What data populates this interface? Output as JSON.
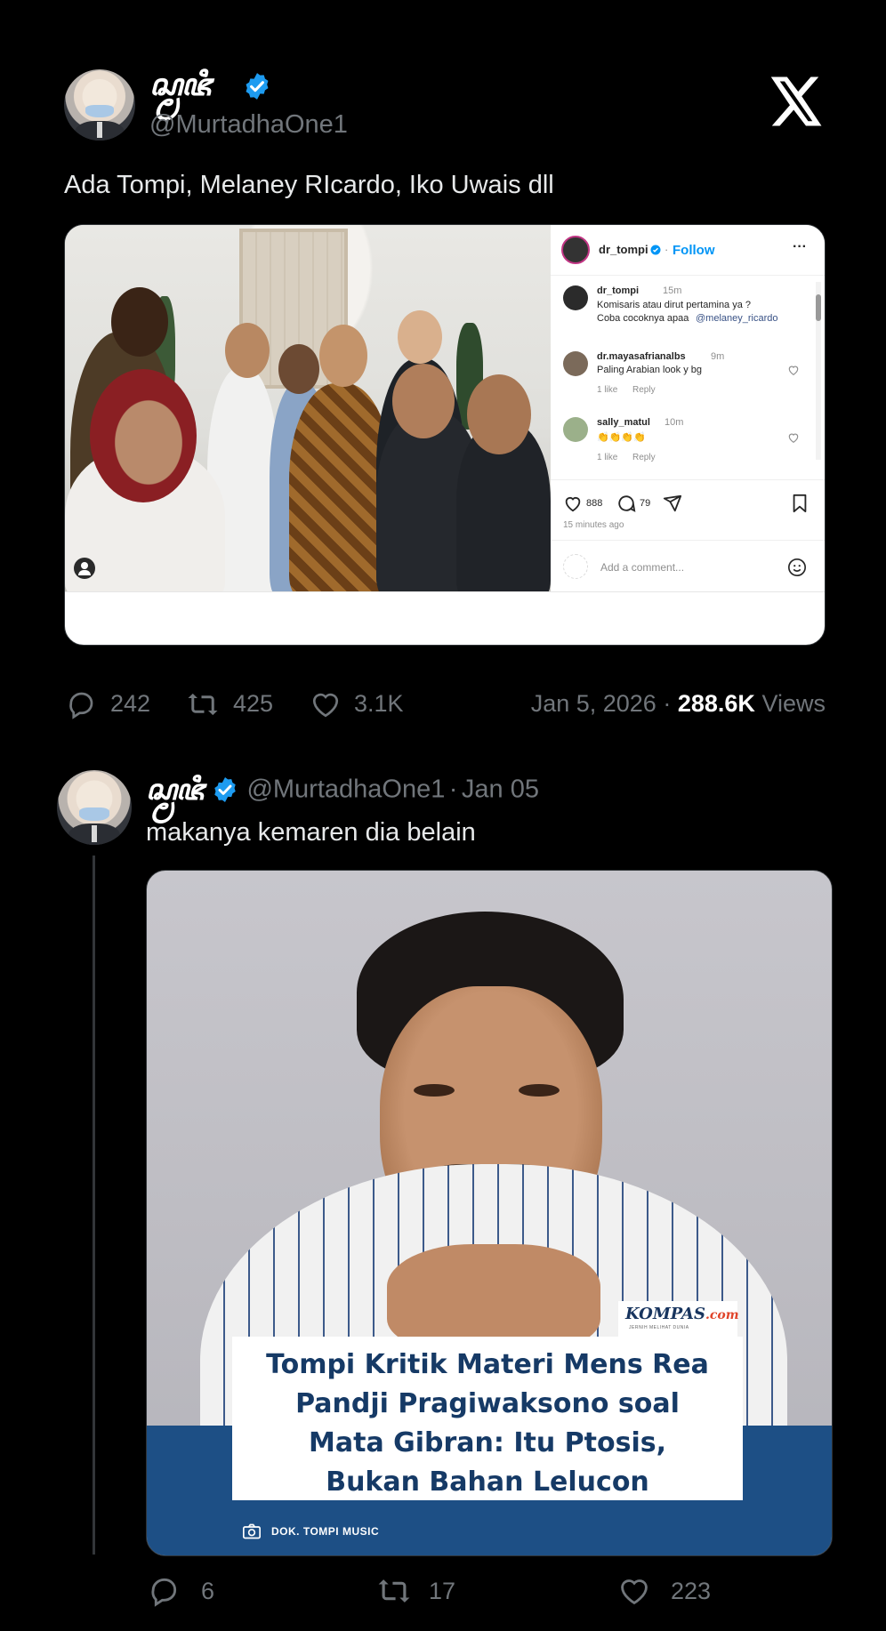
{
  "tweet": {
    "display_name": "ꦱ꧀ꦩꦗꦶ",
    "handle": "@MurtadhaOne1",
    "text": "Ada Tompi, Melaney RIcardo, Iko Uwais dll",
    "date": "Jan 5, 2026",
    "separator": "·",
    "views_count": "288.6K",
    "views_label": "Views",
    "replies": "242",
    "retweets": "425",
    "likes": "3.1K",
    "instagram_card": {
      "username": "dr_tompi",
      "follow_separator": "·",
      "follow_label": "Follow",
      "more": "···",
      "comments": [
        {
          "user": "dr_tompi",
          "time": "15m",
          "text_line1": "Komisaris atau dirut pertamina ya ?",
          "text_line2": "Coba cocoknya apaa",
          "mention": "@melaney_ricardo"
        },
        {
          "user": "dr.mayasafrianalbs",
          "time": "9m",
          "text": "Paling Arabian look y bg",
          "likes": "1 like",
          "reply": "Reply"
        },
        {
          "user": "sally_matul",
          "time": "10m",
          "text": "👏👏👏👏",
          "likes": "1 like",
          "reply": "Reply"
        }
      ],
      "like_count": "888",
      "comment_count": "79",
      "timestamp": "15 minutes ago",
      "add_comment_placeholder": "Add a comment..."
    }
  },
  "reply": {
    "display_name": "ꦱ꧀ꦩꦗꦶ",
    "handle": "@MurtadhaOne1",
    "separator": "·",
    "date": "Jan 05",
    "text": "makanya kemaren dia belain",
    "media": {
      "brand": "KOMPAS",
      "brand_suffix": ".com",
      "brand_tagline": "JERNIH MELIHAT DUNIA",
      "headline_1": "Tompi Kritik Materi Mens Rea",
      "headline_2": "Pandji Pragiwaksono soal",
      "headline_3": "Mata Gibran: Itu Ptosis,",
      "headline_4": "Bukan Bahan Lelucon",
      "credit": "DOK. TOMPI MUSIC"
    },
    "replies": "6",
    "retweets": "17",
    "likes": "223"
  },
  "colors": {
    "background": "#000000",
    "text": "#e7e9ea",
    "muted": "#71767b",
    "verified": "#1d9bf0",
    "kompas_blue": "#1d4f85"
  },
  "icons": [
    "x-logo-icon",
    "verified-badge-icon",
    "reply-icon",
    "retweet-icon",
    "like-icon",
    "share-icon",
    "bookmark-icon",
    "camera-icon"
  ]
}
